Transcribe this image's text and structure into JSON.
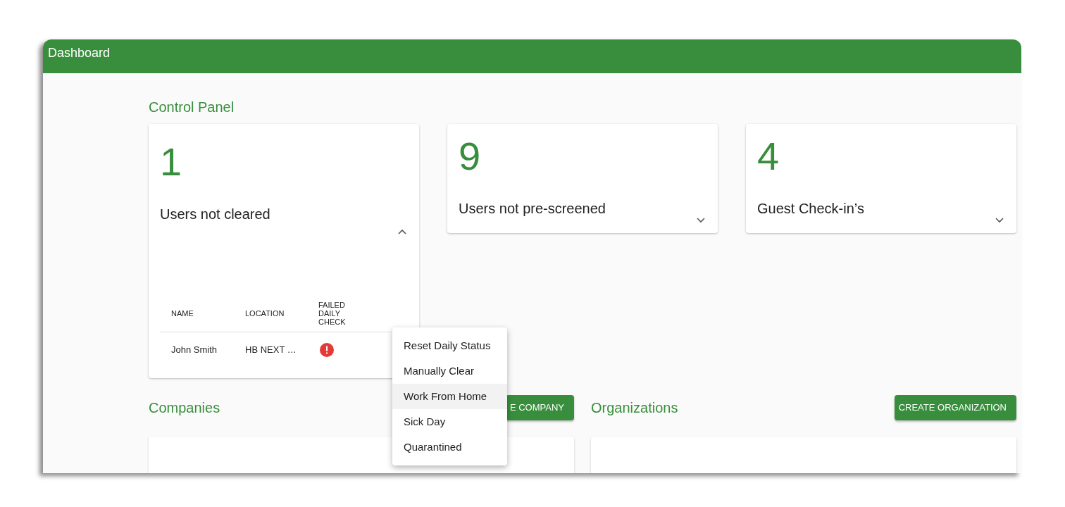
{
  "window": {
    "title": "Dashboard"
  },
  "control_panel": {
    "title": "Control Panel",
    "cards": [
      {
        "count": "1",
        "label": "Users not cleared",
        "expanded": true,
        "table": {
          "columns": [
            "NAME",
            "LOCATION",
            "FAILED DAILY CHECK"
          ],
          "rows": [
            {
              "name": "John Smith",
              "location": "HB NEXT …",
              "failed": true
            }
          ]
        }
      },
      {
        "count": "9",
        "label": "Users not pre-screened",
        "expanded": false
      },
      {
        "count": "4",
        "label": "Guest Check-in’s",
        "expanded": false
      }
    ]
  },
  "row_menu": {
    "items": [
      {
        "label": "Reset Daily Status",
        "selected": false
      },
      {
        "label": "Manually Clear",
        "selected": false
      },
      {
        "label": "Work From Home",
        "selected": true
      },
      {
        "label": "Sick Day",
        "selected": false
      },
      {
        "label": "Quarantined",
        "selected": false
      }
    ]
  },
  "sections": [
    {
      "title": "Companies",
      "button": "E COMPANY"
    },
    {
      "title": "Organizations",
      "button": "CREATE ORGANIZATION"
    }
  ]
}
